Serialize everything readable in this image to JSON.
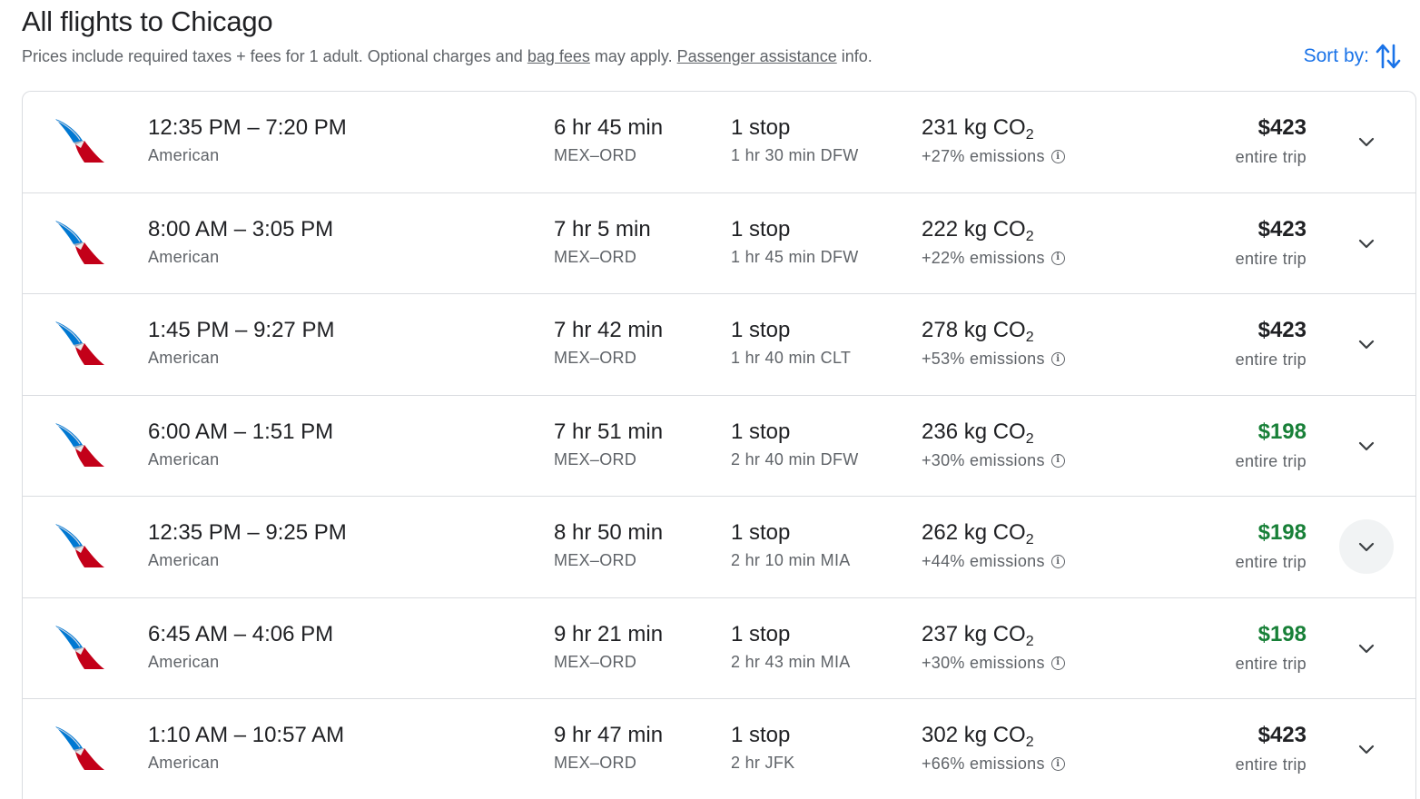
{
  "header": {
    "title": "All flights to Chicago",
    "subtitle_part1": "Prices include required taxes + fees for 1 adult. Optional charges and ",
    "bag_fees_link": "bag fees",
    "subtitle_part2": " may apply. ",
    "assistance_link": "Passenger assistance",
    "subtitle_part3": " info."
  },
  "sort": {
    "label": "Sort by:",
    "icon": "swap-vert-icon"
  },
  "colors": {
    "accent": "#1a73e8",
    "low_price": "#188038",
    "text": "#202124",
    "secondary": "#5f6368",
    "border": "#dadce0"
  },
  "flights": [
    {
      "times": "12:35 PM – 7:20 PM",
      "airline": "American",
      "duration": "6 hr 45 min",
      "route": "MEX–ORD",
      "stops": "1 stop",
      "layover": "1 hr 30 min DFW",
      "co2_value": "231 kg CO",
      "co2_sub": "2",
      "emissions": "+27% emissions",
      "price": "$423",
      "trip_type": "entire trip",
      "low_price": false
    },
    {
      "times": "8:00 AM – 3:05 PM",
      "airline": "American",
      "duration": "7 hr 5 min",
      "route": "MEX–ORD",
      "stops": "1 stop",
      "layover": "1 hr 45 min DFW",
      "co2_value": "222 kg CO",
      "co2_sub": "2",
      "emissions": "+22% emissions",
      "price": "$423",
      "trip_type": "entire trip",
      "low_price": false
    },
    {
      "times": "1:45 PM – 9:27 PM",
      "airline": "American",
      "duration": "7 hr 42 min",
      "route": "MEX–ORD",
      "stops": "1 stop",
      "layover": "1 hr 40 min CLT",
      "co2_value": "278 kg CO",
      "co2_sub": "2",
      "emissions": "+53% emissions",
      "price": "$423",
      "trip_type": "entire trip",
      "low_price": false
    },
    {
      "times": "6:00 AM – 1:51 PM",
      "airline": "American",
      "duration": "7 hr 51 min",
      "route": "MEX–ORD",
      "stops": "1 stop",
      "layover": "2 hr 40 min DFW",
      "co2_value": "236 kg CO",
      "co2_sub": "2",
      "emissions": "+30% emissions",
      "price": "$198",
      "trip_type": "entire trip",
      "low_price": true
    },
    {
      "times": "12:35 PM – 9:25 PM",
      "airline": "American",
      "duration": "8 hr 50 min",
      "route": "MEX–ORD",
      "stops": "1 stop",
      "layover": "2 hr 10 min MIA",
      "co2_value": "262 kg CO",
      "co2_sub": "2",
      "emissions": "+44% emissions",
      "price": "$198",
      "trip_type": "entire trip",
      "low_price": true
    },
    {
      "times": "6:45 AM – 4:06 PM",
      "airline": "American",
      "duration": "9 hr 21 min",
      "route": "MEX–ORD",
      "stops": "1 stop",
      "layover": "2 hr 43 min MIA",
      "co2_value": "237 kg CO",
      "co2_sub": "2",
      "emissions": "+30% emissions",
      "price": "$198",
      "trip_type": "entire trip",
      "low_price": true
    },
    {
      "times": "1:10 AM – 10:57 AM",
      "airline": "American",
      "duration": "9 hr 47 min",
      "route": "MEX–ORD",
      "stops": "1 stop",
      "layover": "2 hr JFK",
      "co2_value": "302 kg CO",
      "co2_sub": "2",
      "emissions": "+66% emissions",
      "price": "$423",
      "trip_type": "entire trip",
      "low_price": false
    }
  ],
  "icons": {
    "airline_logo": "american-airlines-logo-icon",
    "info": "info-icon",
    "expand": "chevron-down-icon"
  }
}
